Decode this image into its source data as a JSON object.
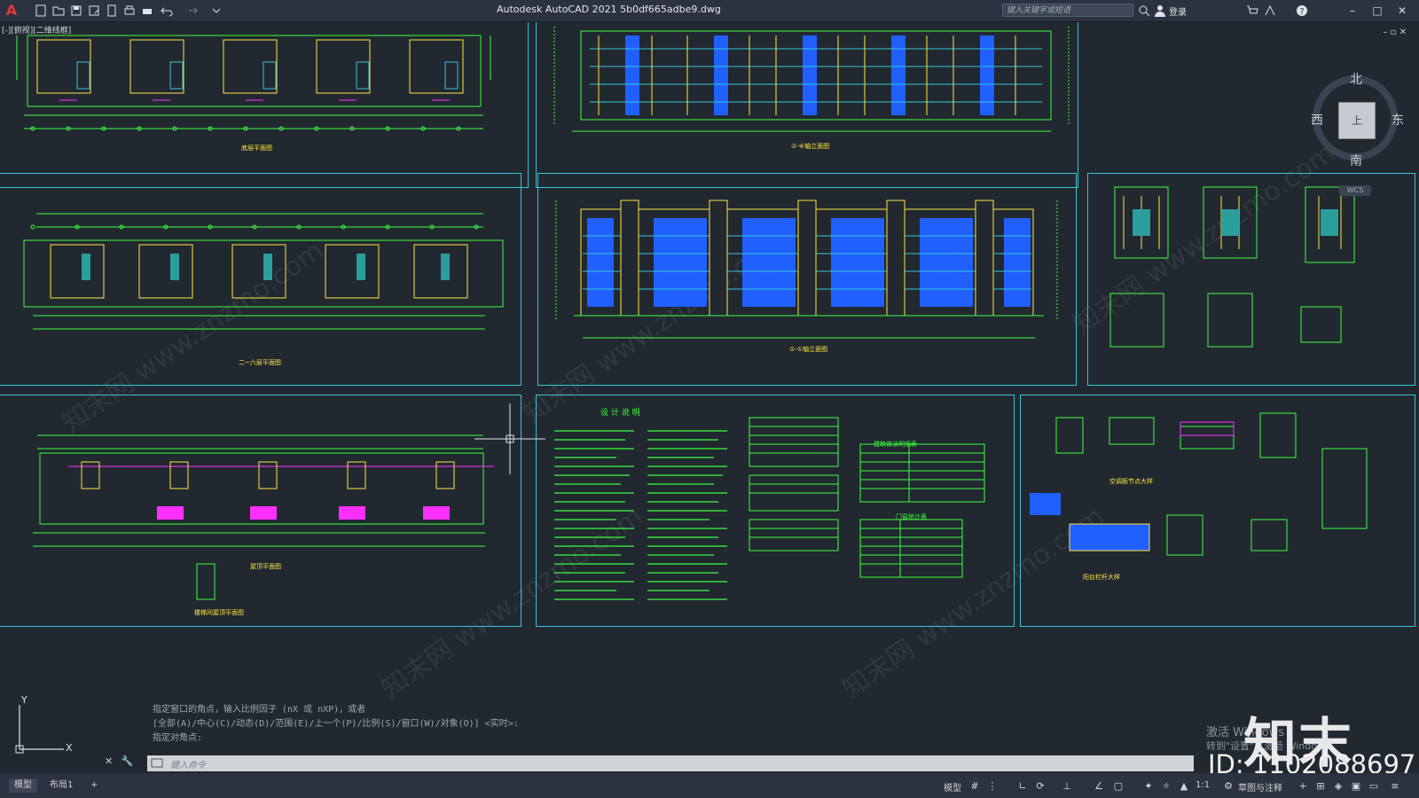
{
  "app": {
    "title": "Autodesk AutoCAD 2021    5b0df665adbe9.dwg",
    "logo": "A",
    "search_placeholder": "键入关键字或短语",
    "login": "登录"
  },
  "viewport_label": "[-][俯视][二维线框]",
  "viewcube": {
    "north": "北",
    "south": "南",
    "west": "西",
    "east": "东",
    "face": "上",
    "wcs": "WCS"
  },
  "sheet_captions": {
    "plan_ground": "底层平面图",
    "plan_typical": "二~六层平面图",
    "plan_roof": "屋顶平面图",
    "plan_stair_roof": "楼梯间屋顶平面图",
    "elev_top": "①-⑥轴立面图",
    "elev_mid": "①-①轴立面图",
    "design_notes": "设 计 说 明",
    "door_window": "门窗统计表",
    "tables_title": "建筑做法明细表",
    "detail_1": "空调板节点大样",
    "detail_2": "阳台栏杆大样"
  },
  "command_history": [
    "指定窗口的角点，输入比例因子 (nX 或 nXP)，或者",
    "[全部(A)/中心(C)/动态(D)/范围(E)/上一个(P)/比例(S)/窗口(W)/对象(O)] <实时>:",
    "指定对角点:"
  ],
  "command_placeholder": "键入命令",
  "tabs": [
    {
      "label": "模型",
      "active": true
    },
    {
      "label": "布局1",
      "active": false
    },
    {
      "label": "+",
      "active": false
    }
  ],
  "status": {
    "model_label": "模型",
    "scale": "1:1",
    "annot": "草图与注释"
  },
  "watermark": {
    "brand": "知末",
    "id": "ID: 1102088697",
    "site": "知末网 www.znzmo.com"
  },
  "activate_windows": {
    "line1": "激活 Windows",
    "line2": "转到\"设置\"以激活 Windows。"
  },
  "colors": {
    "bg": "#212830",
    "sheet": "#33c6d6",
    "line": "#3aff3a",
    "accent": "#ffe640",
    "blue": "#2060ff",
    "magenta": "#ff30ff"
  }
}
